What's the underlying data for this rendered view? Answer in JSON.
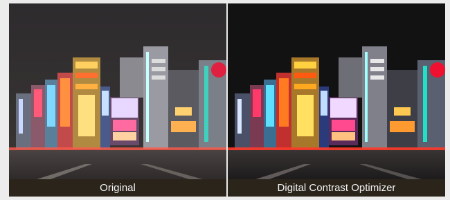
{
  "panels": [
    {
      "caption": "Original"
    },
    {
      "caption": "Digital Contrast Optimizer"
    }
  ],
  "colors": {
    "page_background": "#ececec",
    "caption_bar": "#2a241b",
    "caption_text": "#f2f2f2",
    "sky_original": "#2c2a2c",
    "sky_optimized": "#121212"
  }
}
